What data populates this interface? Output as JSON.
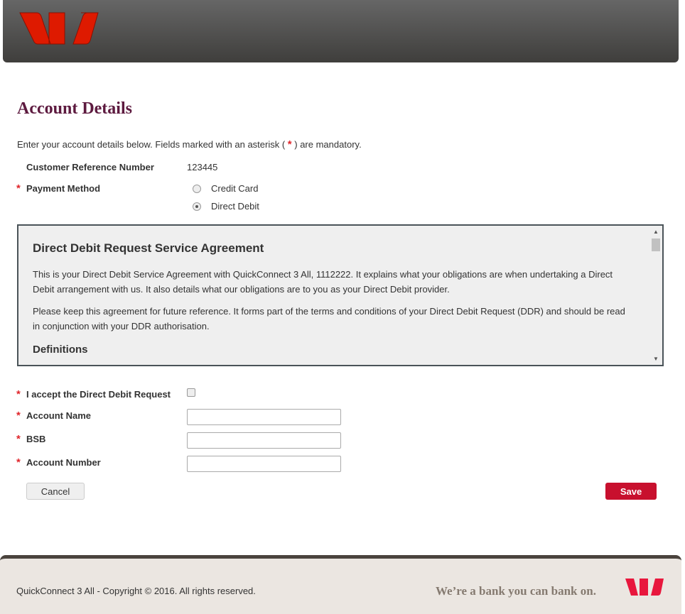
{
  "header": {
    "logo": "Westpac"
  },
  "page_title": "Account Details",
  "intro": {
    "before": "Enter your account details below. Fields marked with an asterisk (",
    "asterisk": "*",
    "after": ") are mandatory."
  },
  "customer_ref": {
    "label": "Customer Reference Number",
    "value": "123445"
  },
  "payment_method": {
    "label": "Payment Method",
    "options": [
      "Credit Card",
      "Direct Debit"
    ],
    "selected": "Direct Debit"
  },
  "agreement": {
    "title": "Direct Debit Request Service Agreement",
    "paragraphs": [
      "This is your Direct Debit Service Agreement with QuickConnect 3 All, 1112222. It explains what your obligations are when undertaking a Direct Debit arrangement with us. It also details what our obligations are to you as your Direct Debit provider.",
      "Please keep this agreement for future reference. It forms part of the terms and conditions of your Direct Debit Request (DDR) and should be read in conjunction with your DDR authorisation."
    ],
    "subheading": "Definitions"
  },
  "form": {
    "accept_label": "I accept the Direct Debit Request",
    "account_name_label": "Account Name",
    "bsb_label": "BSB",
    "account_number_label": "Account Number",
    "cancel": "Cancel",
    "save": "Save"
  },
  "footer": {
    "copyright": "QuickConnect 3 All - Copyright © 2016. All rights reserved.",
    "tagline": "We’re a bank you can bank on."
  },
  "colors": {
    "brand_red": "#c8102e",
    "title": "#5d1a3f"
  }
}
